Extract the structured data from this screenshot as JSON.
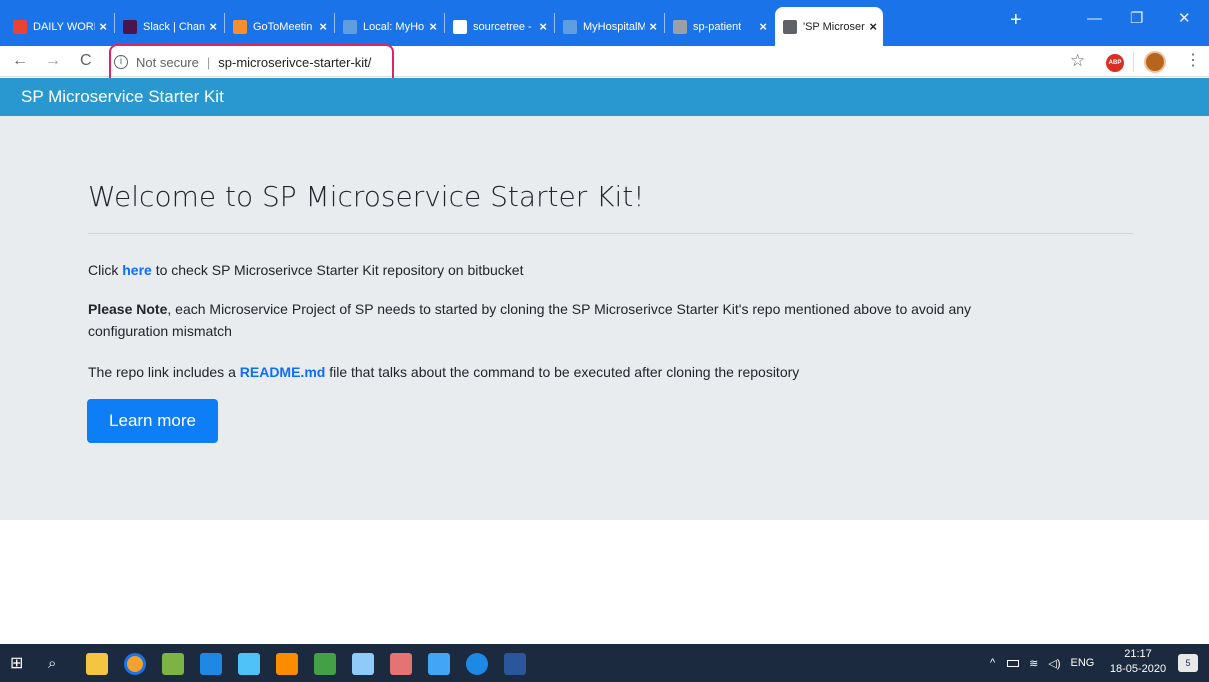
{
  "browser": {
    "tabs": [
      {
        "title": "DAILY WORK",
        "icon": "gmail-icon",
        "color": "#ea4335"
      },
      {
        "title": "Slack | Chan",
        "icon": "slack-icon",
        "color": "#4a154b"
      },
      {
        "title": "GoToMeetin",
        "icon": "gotomeeting-icon",
        "color": "#f68d2e"
      },
      {
        "title": "Local: MyHo",
        "icon": "globe-icon",
        "color": "#5f9ee0"
      },
      {
        "title": "sourcetree -",
        "icon": "google-icon",
        "color": "#ffffff"
      },
      {
        "title": "MyHospitalM",
        "icon": "globe-icon",
        "color": "#5f9ee0"
      },
      {
        "title": "sp-patient",
        "icon": "globe-icon",
        "color": "#9aa0a6"
      },
      {
        "title": "'SP Microser",
        "icon": "globe-icon",
        "color": "#5f6368"
      }
    ],
    "close_glyph": "×",
    "new_tab_glyph": "+",
    "minimize_glyph": "—",
    "restore_glyph": "❐",
    "close_window_glyph": "✕",
    "nav": {
      "back": "←",
      "forward": "→",
      "reload": "C"
    },
    "address": {
      "security": "Not secure",
      "url": "sp-microserivce-starter-kit/"
    },
    "star_glyph": "☆",
    "abp_label": "ABP",
    "menu_glyph": "⋮"
  },
  "page": {
    "navbar_brand": "SP Microservice Starter Kit",
    "heading": "Welcome to SP Microservice Starter Kit!",
    "p1_before": "Click ",
    "p1_link": "here",
    "p1_after": " to check SP Microserivce Starter Kit repository on bitbucket",
    "p2_strong": "Please Note",
    "p2_line1": ", each Microservice Project of SP needs to started by cloning the SP Microserivce Starter Kit's repo mentioned above to avoid any",
    "p2_line2": "configuration mismatch",
    "p3_before": "The repo link includes a ",
    "p3_link": "README.md",
    "p3_after": " file that talks about the command to be executed after cloning the repository",
    "button_label": "Learn more"
  },
  "taskbar": {
    "apps": [
      {
        "name": "start-icon",
        "color": "#ffffff"
      },
      {
        "name": "search-icon",
        "color": "#ffffff"
      },
      {
        "name": "file-explorer-icon",
        "color": "#f4c542"
      },
      {
        "name": "chrome-icon",
        "color": "#f4a22d"
      },
      {
        "name": "image-viewer-icon",
        "color": "#7cb342"
      },
      {
        "name": "maps-icon",
        "color": "#1e88e5"
      },
      {
        "name": "pen-icon",
        "color": "#4fc3f7"
      },
      {
        "name": "xampp-icon",
        "color": "#fb8c00"
      },
      {
        "name": "sourcetree-icon",
        "color": "#43a047"
      },
      {
        "name": "paint-icon",
        "color": "#90caf9"
      },
      {
        "name": "snipping-icon",
        "color": "#e57373"
      },
      {
        "name": "photos-icon",
        "color": "#42a5f5"
      },
      {
        "name": "edge-icon",
        "color": "#1e88e5"
      },
      {
        "name": "word-icon",
        "color": "#2b579a"
      }
    ],
    "tray_arrow": "^",
    "language": "ENG",
    "time": "21:17",
    "date": "18-05-2020",
    "notifications": "5"
  }
}
